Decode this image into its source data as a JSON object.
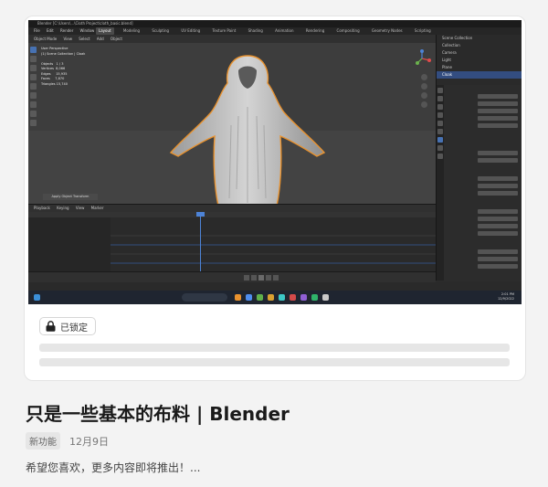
{
  "post": {
    "title": "只是一些基本的布料 | Blender",
    "badge": "新功能",
    "date": "12月9日",
    "description": "希望您喜欢，更多内容即将推出！...",
    "lock_label": "已锁定"
  },
  "screenshot": {
    "window_title": "Blender [C:\\Users\\...\\Cloth Project\\cloth_basic.blend]",
    "menu": [
      "File",
      "Edit",
      "Render",
      "Window",
      "Help"
    ],
    "workspace_tabs": [
      "Layout",
      "Modeling",
      "Sculpting",
      "UV Editing",
      "Texture Paint",
      "Shading",
      "Animation",
      "Rendering",
      "Compositing",
      "Geometry Nodes",
      "Scripting"
    ],
    "active_tab": "Layout",
    "viewport_header": [
      "Object Mode",
      "View",
      "Select",
      "Add",
      "Object"
    ],
    "stats": "User Perspective\n(1) Scene Collection | Cloak\n\nObjects   1 / 3\nVertices  8,066\nEdges     15,935\nFaces     7,870\nTriangles 15,740",
    "viewport_button": "Apply Object Transform",
    "outliner": [
      "Scene Collection",
      "Collection",
      "Camera",
      "Light",
      "Plane",
      "Cloak"
    ],
    "selected_object": "Cloak",
    "timeline_menu": [
      "Playback",
      "Keying",
      "View",
      "Marker"
    ],
    "clock": "2:01 PM\n12/9/2022",
    "colors": {
      "accent": "#4772b3",
      "playhead": "#4d83d6",
      "outline": "#e8922f"
    }
  }
}
